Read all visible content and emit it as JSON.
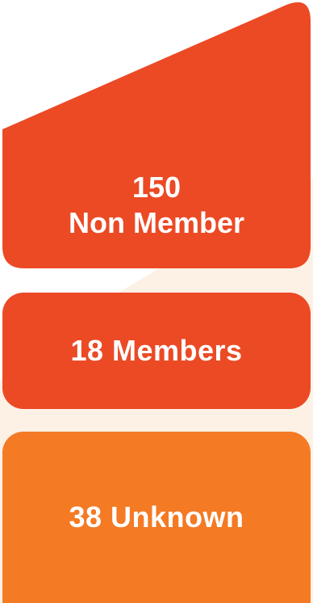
{
  "colors": {
    "non_member": "#eb4a25",
    "members": "#eb4a25",
    "unknown": "#f47a24",
    "background_tint": "#fdf1e6"
  },
  "segments": [
    {
      "value": "150",
      "label": "Non Member"
    },
    {
      "label": "18 Members"
    },
    {
      "label": "38 Unknown"
    }
  ]
}
